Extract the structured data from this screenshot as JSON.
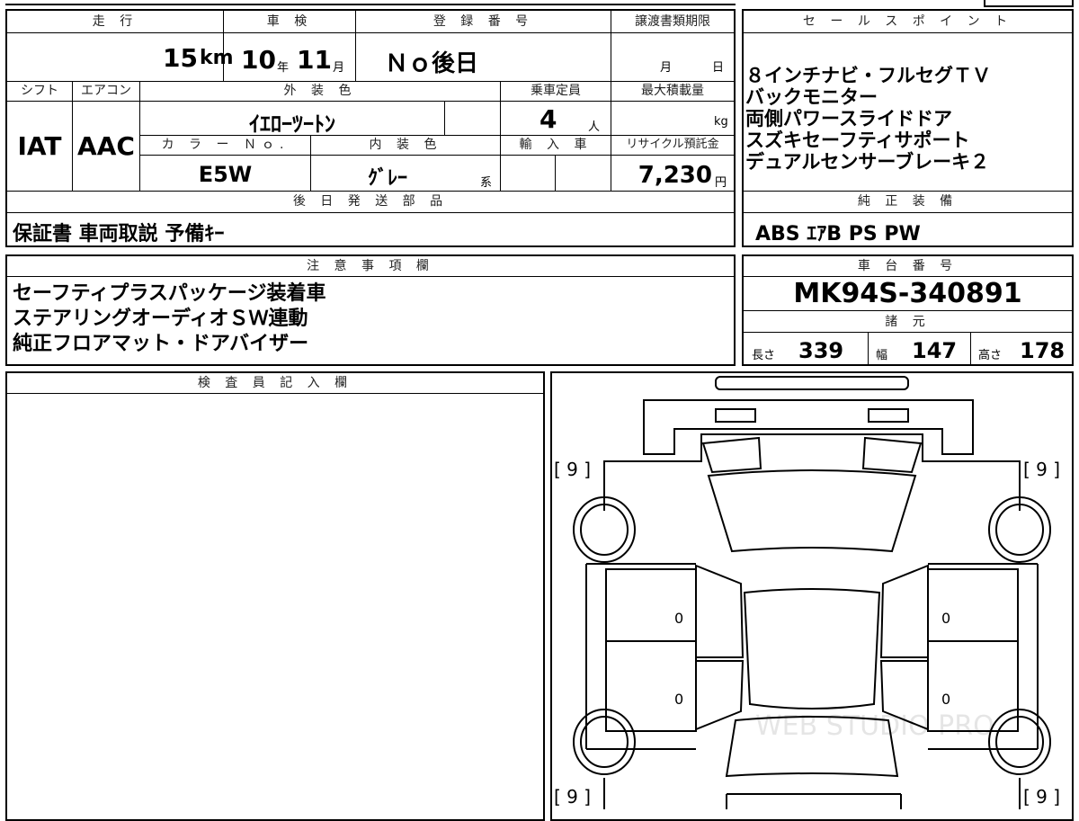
{
  "top": {
    "hdr_mileage": "走 行",
    "hdr_inspection": "車 検",
    "hdr_reg": "登 録 番 号",
    "hdr_transfer": "譲渡書類期限",
    "mileage_value": "15",
    "mileage_unit": "km",
    "inspection_year": "10",
    "year_unit": "年",
    "inspection_month": "11",
    "month_unit": "月",
    "reg_value": "Ｎｏ後日",
    "transfer_month_unit": "月",
    "transfer_day_unit": "日",
    "hdr_shift": "シフト",
    "hdr_ac": "エアコン",
    "hdr_exterior": "外 装 色",
    "hdr_capacity": "乗車定員",
    "hdr_load": "最大積載量",
    "shift_value": "IAT",
    "ac_value": "AAC",
    "exterior_value": "ｲｴﾛｰﾂｰﾄﾝ",
    "capacity_value": "4",
    "capacity_unit": "人",
    "load_unit": "kg",
    "hdr_color_no": "カ ラ ー Ｎｏ.",
    "hdr_interior": "内 装 色",
    "hdr_import": "輸 入 車",
    "hdr_recycle": "リサイクル預託金",
    "color_no_value": "E5W",
    "interior_value": "ｸﾞﾚｰ",
    "interior_suffix": "系",
    "recycle_value": "7,230",
    "recycle_unit": "円",
    "hdr_later_parts": "後 日 発 送 部 品",
    "later_parts_value": "保証書 車両取説 予備ｷｰ"
  },
  "sales": {
    "header": "セ ー ル ス ポ イ ン ト",
    "lines": [
      "８インチナビ・フルセグＴＶ",
      "バックモニター",
      "両側パワースライドドア",
      "スズキセーフティサポート",
      "デュアルセンサーブレーキ２"
    ],
    "equip_header": "純 正 装 備",
    "equip_value": "ABS ｴｱB PS PW"
  },
  "notes": {
    "header": "注 意 事 項 欄",
    "lines": [
      "セーフティプラスパッケージ装着車",
      "ステアリングオーディオＳＷ連動",
      "純正フロアマット・ドアバイザー"
    ]
  },
  "chassis": {
    "header": "車 台 番 号",
    "value": "MK94S-340891",
    "spec_header": "諸 元",
    "length_label": "長さ",
    "length_value": "339",
    "width_label": "幅",
    "width_value": "147",
    "height_label": "高さ",
    "height_value": "178"
  },
  "inspector": {
    "header": "検 査 員 記 入 欄"
  },
  "diagram": {
    "tire_front_left": "[ 9 ]",
    "tire_front_right": "[ 9 ]",
    "tire_rear_left": "[ 9 ]",
    "tire_rear_right": "[ 9 ]",
    "door_mark_1": "0",
    "door_mark_2": "0",
    "door_mark_3": "0",
    "door_mark_4": "0",
    "watermark": "WEB STUDIO PRO"
  }
}
